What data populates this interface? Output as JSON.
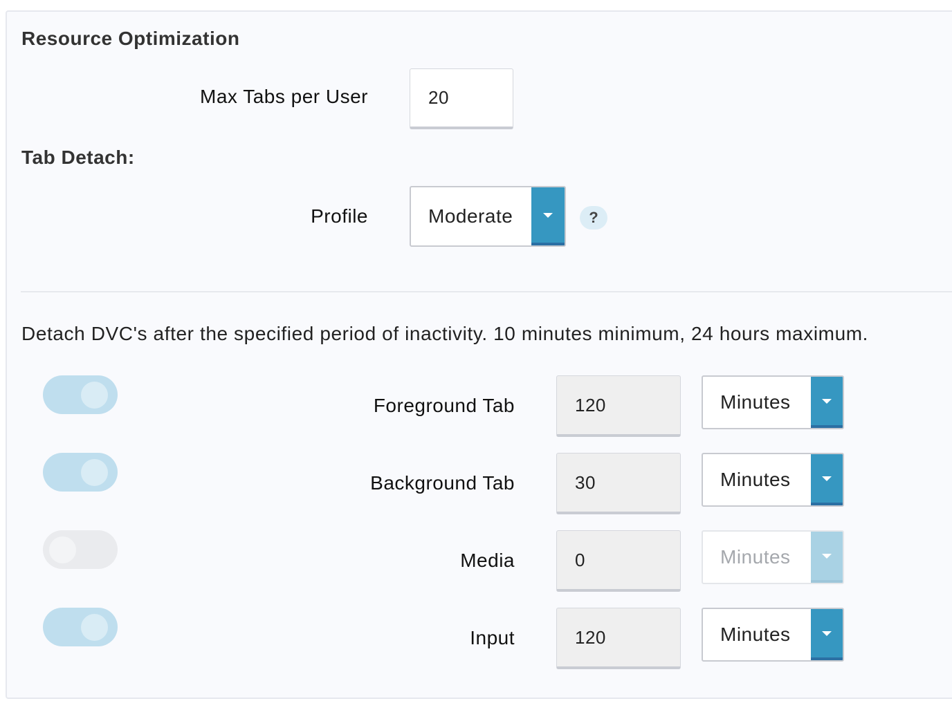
{
  "section": {
    "title": "Resource Optimization",
    "max_tabs_label": "Max Tabs per User",
    "max_tabs_value": "20",
    "tab_detach_title": "Tab Detach:",
    "profile_label": "Profile",
    "profile_value": "Moderate",
    "help_glyph": "?",
    "description": "Detach DVC's after the specified period of inactivity. 10 minutes minimum, 24 hours maximum."
  },
  "rows": [
    {
      "label": "Foreground Tab",
      "value": "120",
      "unit": "Minutes",
      "enabled": true
    },
    {
      "label": "Background Tab",
      "value": "30",
      "unit": "Minutes",
      "enabled": true
    },
    {
      "label": "Media",
      "value": "0",
      "unit": "Minutes",
      "enabled": false
    },
    {
      "label": "Input",
      "value": "120",
      "unit": "Minutes",
      "enabled": true
    }
  ],
  "colors": {
    "accent": "#3697c1",
    "toggle_on": "#bfdeee",
    "toggle_off": "#eaebee"
  },
  "icons": {
    "dropdown": "chevron-down-icon",
    "help": "question-mark-icon"
  }
}
